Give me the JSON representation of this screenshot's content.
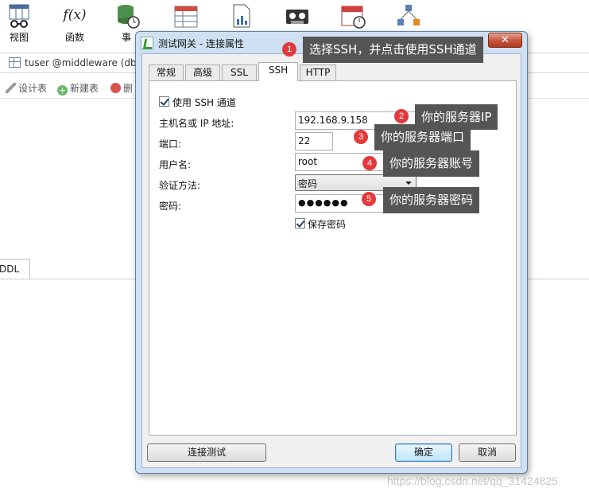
{
  "toolbar": {
    "items": [
      {
        "label": "视图",
        "icon": "view-icon"
      },
      {
        "label": "函数",
        "icon": "function-icon"
      },
      {
        "label": "事",
        "icon": "event-icon"
      },
      {
        "label": "",
        "icon": "report-icon"
      },
      {
        "label": "",
        "icon": "chart-icon"
      },
      {
        "label": "",
        "icon": "backup-icon"
      },
      {
        "label": "",
        "icon": "schedule-icon"
      },
      {
        "label": "",
        "icon": "model-icon"
      }
    ],
    "f_glyph": "f(x)"
  },
  "address_bar": {
    "text": "tuser @middleware (db"
  },
  "subtoolbar": {
    "design": "设计表",
    "new": "新建表",
    "delete": "删"
  },
  "ddl_tab": "DDL",
  "dialog": {
    "title": "测试网关 - 连接属性",
    "close": "✕",
    "tabs": [
      "常规",
      "高级",
      "SSL",
      "SSH",
      "HTTP"
    ],
    "active_tab": "SSH",
    "ssh": {
      "use_ssh_label": "使用 SSH 通道",
      "host_label": "主机名或 IP 地址:",
      "host_value": "192.168.9.158",
      "port_label": "端口:",
      "port_value": "22",
      "user_label": "用户名:",
      "user_value": "root",
      "auth_label": "验证方法:",
      "auth_value": "密码",
      "password_label": "密码:",
      "password_value": "●●●●●●",
      "save_password_label": "保存密码"
    },
    "buttons": {
      "test": "连接测试",
      "ok": "确定",
      "cancel": "取消"
    }
  },
  "annotations": [
    {
      "num": "1",
      "text": "选择SSH，并点击使用SSH通道"
    },
    {
      "num": "2",
      "text": "你的服务器IP"
    },
    {
      "num": "3",
      "text": "你的服务器端口"
    },
    {
      "num": "4",
      "text": "你的服务器账号"
    },
    {
      "num": "5",
      "text": "你的服务器密码"
    }
  ],
  "watermark": "https://blog.csdn.net/qq_31424825",
  "colors": {
    "callout_bg": "#555555",
    "badge": "#e23a3a",
    "dialog_frame": "#cfe0f3"
  }
}
